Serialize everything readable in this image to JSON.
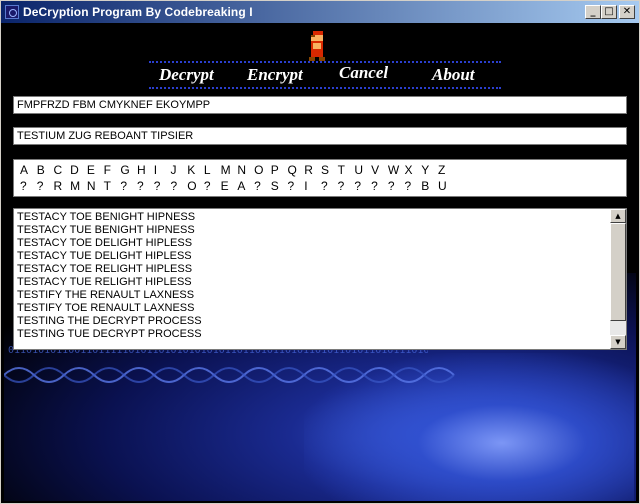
{
  "window": {
    "title": "DeCryption Program By Codebreaking I"
  },
  "titlebar_buttons": {
    "minimize": "_",
    "maximize": "□",
    "close": "✕"
  },
  "menu": {
    "decrypt": "Decrypt",
    "encrypt": "Encrypt",
    "cancel": "Cancel",
    "about": "About"
  },
  "ciphertext": "FMPFRZD FBM CMYKNEF EKOYMPP",
  "plaintext": "TESTIUM ZUG REBOANT TIPSIER",
  "key": {
    "alphabet": [
      "A",
      "B",
      "C",
      "D",
      "E",
      "F",
      "G",
      "H",
      "I",
      "J",
      "K",
      "L",
      "M",
      "N",
      "O",
      "P",
      "Q",
      "R",
      "S",
      "T",
      "U",
      "V",
      "W",
      "X",
      "Y",
      "Z"
    ],
    "mapping": [
      "?",
      "?",
      "R",
      "M",
      "N",
      "T",
      "?",
      "?",
      "?",
      "?",
      "O",
      "?",
      "E",
      "A",
      "?",
      "S",
      "?",
      "I",
      "?",
      "?",
      "?",
      "?",
      "?",
      "?",
      "B",
      "U"
    ]
  },
  "candidates": [
    "TESTACY TOE BENIGHT HIPNESS",
    "TESTACY TUE BENIGHT HIPNESS",
    "TESTACY TOE DELIGHT HIPLESS",
    "TESTACY TUE DELIGHT HIPLESS",
    "TESTACY TOE RELIGHT HIPLESS",
    "TESTACY TUE RELIGHT HIPLESS",
    "TESTIFY THE RENAULT LAXNESS",
    "TESTIFY TOE RENAULT LAXNESS",
    "TESTING THE DECRYPT PROCESS",
    "TESTING TUE DECRYPT PROCESS"
  ],
  "scrollbar": {
    "up": "▲",
    "down": "▼"
  },
  "background": {
    "binary_text": "01101010110011011111010110101010101011011010110101101011010110101110101101011010110"
  },
  "colors": {
    "titlebar_start": "#0a246a",
    "titlebar_end": "#a6caf0",
    "menu_dots": "#2b3fd0",
    "background_glow": "#3a5ad8"
  },
  "icons": {
    "app": "app-icon",
    "mascot": "mario-sprite-icon"
  }
}
